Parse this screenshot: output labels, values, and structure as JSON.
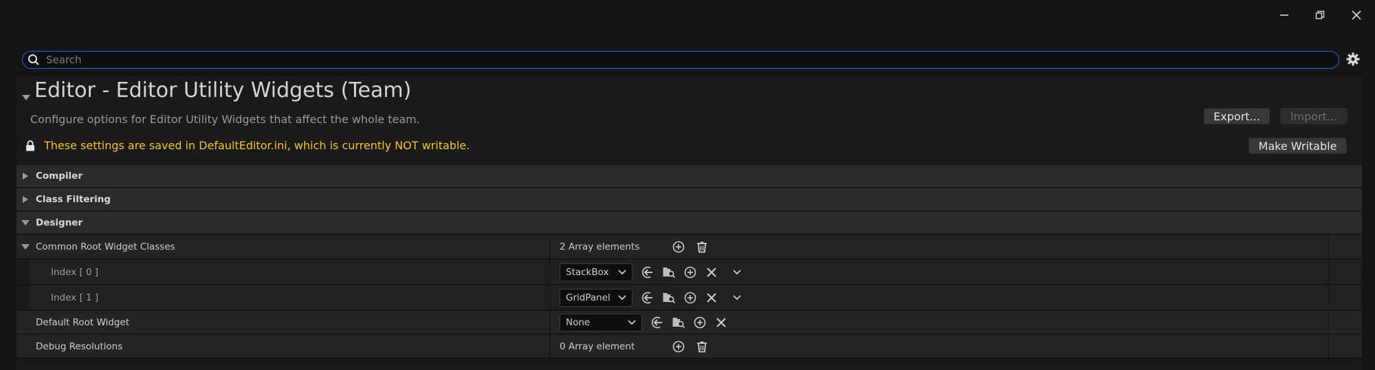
{
  "window": {
    "controls": [
      "minimize-icon",
      "restore-icon",
      "close-icon"
    ]
  },
  "search": {
    "placeholder": "Search",
    "value": ""
  },
  "section": {
    "title": "Editor - Editor Utility Widgets (Team)",
    "description": "Configure options for Editor Utility Widgets that affect the whole team.",
    "export_label": "Export...",
    "import_label": "Import...",
    "warning": "These settings are saved in DefaultEditor.ini, which is currently NOT writable.",
    "make_writable_label": "Make Writable"
  },
  "categories": {
    "compiler": "Compiler",
    "class_filtering": "Class Filtering",
    "designer": "Designer"
  },
  "properties": {
    "common_root": {
      "label": "Common Root Widget Classes",
      "value": "2 Array elements",
      "items": [
        {
          "label": "Index [ 0 ]",
          "value": "StackBox"
        },
        {
          "label": "Index [ 1 ]",
          "value": "GridPanel"
        }
      ]
    },
    "default_root": {
      "label": "Default Root Widget",
      "value": "None"
    },
    "debug_resolutions": {
      "label": "Debug Resolutions",
      "value": "0 Array element"
    }
  },
  "colors": {
    "accent": "#1e6fd9",
    "warning": "#f2c81c",
    "background": "#151515"
  }
}
